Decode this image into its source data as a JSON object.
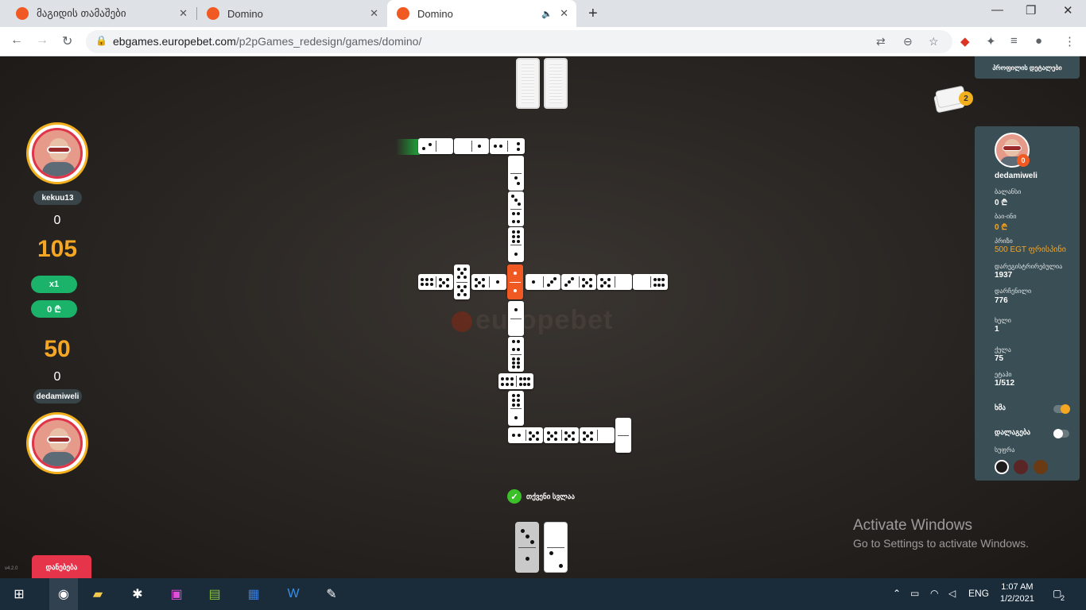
{
  "browser": {
    "tabs": [
      {
        "title": "მაგიდის თამაშები"
      },
      {
        "title": "Domino"
      },
      {
        "title": "Domino"
      }
    ],
    "url_host": "ebgames.europebet.com",
    "url_path": "/p2pGames_redesign/games/domino/"
  },
  "players": {
    "top": {
      "name": "kekuu13",
      "score": "0",
      "points": "105",
      "multiplier": "x1",
      "bet": "0 ₾"
    },
    "bottom": {
      "name": "dedamiweli",
      "score": "0",
      "points": "50"
    }
  },
  "side_panel": {
    "top_button": "პროფილის დეტალები",
    "username": "dedamiweli",
    "badge": "0",
    "rows": [
      {
        "label": "ბალანსი",
        "value": "0 ₾",
        "highlight": false
      },
      {
        "label": "ბაი-ინი",
        "value": "0 ₾",
        "highlight": true
      },
      {
        "label": "პრიზი",
        "value": "500 EGT ფრისპინი",
        "highlight": true
      },
      {
        "label": "დარეგისტრირებულია",
        "value": "1937",
        "highlight": false
      },
      {
        "label": "დარჩენილი",
        "value": "776",
        "highlight": false
      },
      {
        "label": "ხელი",
        "value": "1",
        "highlight": false
      },
      {
        "label": "ქულა",
        "value": "75",
        "highlight": false
      },
      {
        "label": "ეტაპი",
        "value": "1/512",
        "highlight": false
      }
    ],
    "sound_label": "ხმა",
    "sound_on": true,
    "help_label": "დალაგება",
    "help_on": false,
    "table_label": "სუფრა",
    "table_colors": [
      "#1c1c1c",
      "#5a2525",
      "#6a3a15"
    ]
  },
  "game": {
    "deck_count": "2",
    "watermark": "europebet",
    "turn_text": "თქვენი სვლაა",
    "leave_button": "დანებება",
    "version": "v4.2.0"
  },
  "os": {
    "activate_title": "Activate Windows",
    "activate_sub": "Go to Settings to activate Windows.",
    "lang": "ENG",
    "time": "1:07 AM",
    "date": "1/2/2021",
    "notif": "2"
  },
  "colors": {
    "accent": "#f05a22",
    "gold": "#f5a623",
    "green": "#1bb36a",
    "red": "#e6354a"
  }
}
